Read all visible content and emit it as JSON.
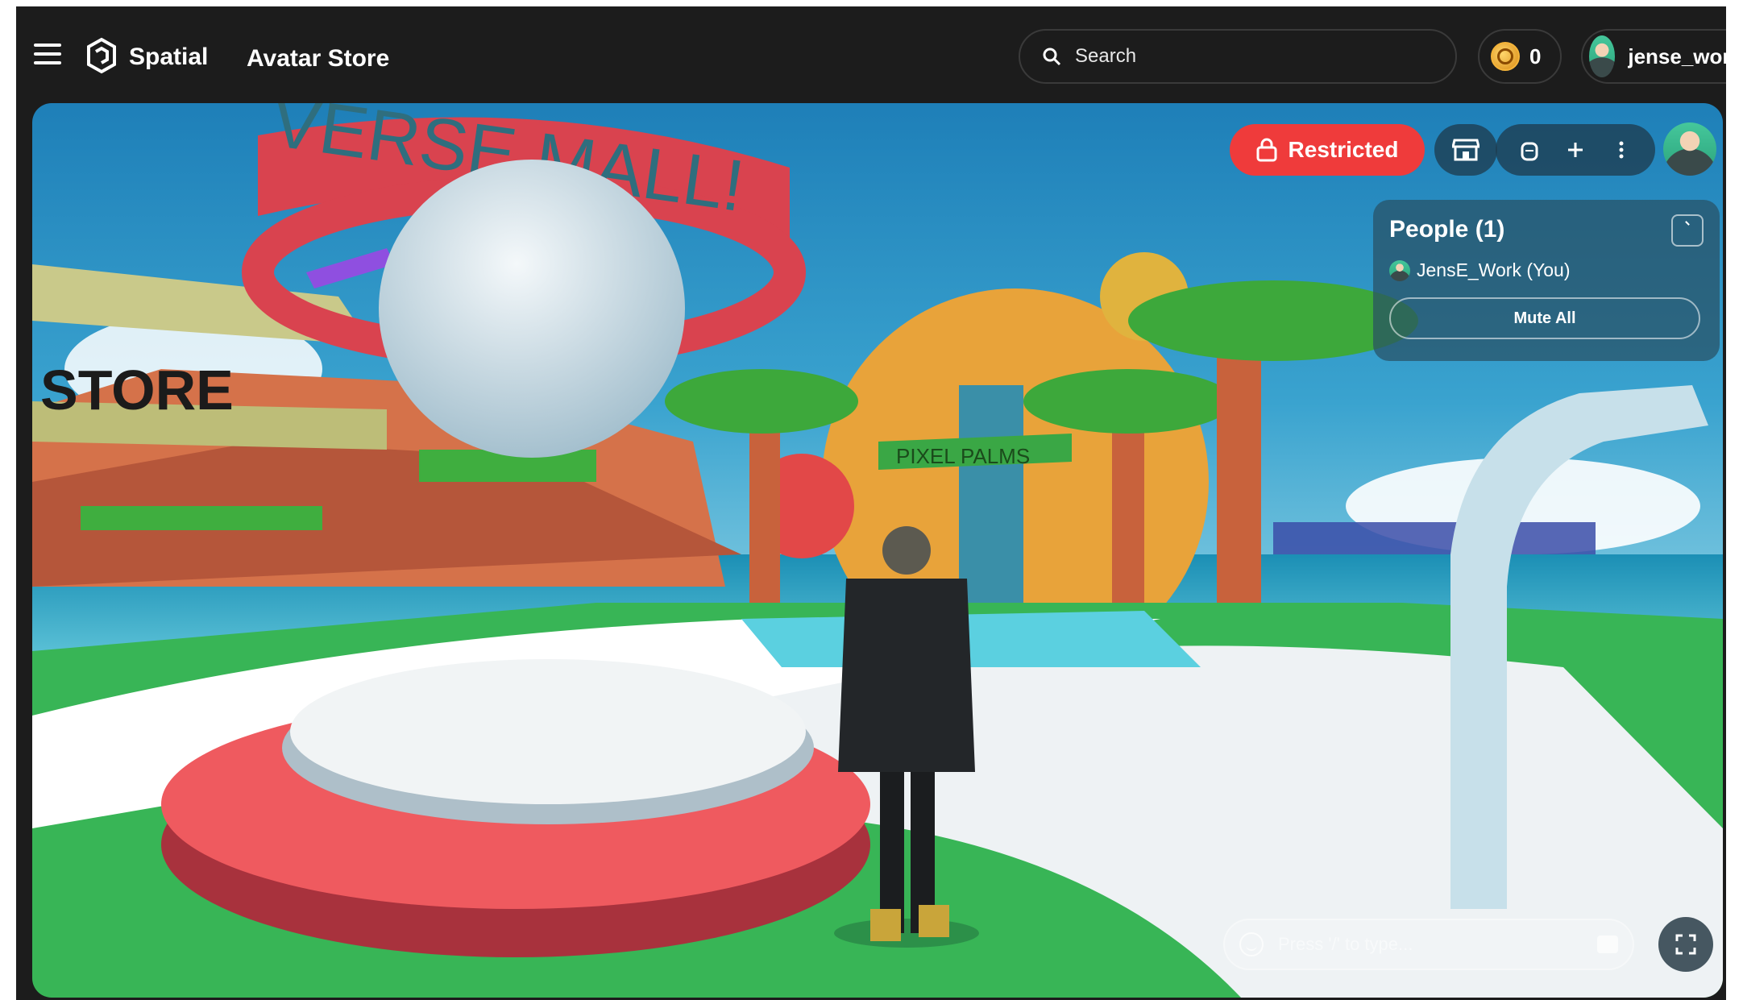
{
  "header": {
    "brand": "Spatial",
    "title": "Avatar Store",
    "search_label": "Search",
    "coin_balance": "0",
    "username": "jense_work"
  },
  "overlay": {
    "restricted_label": "Restricted",
    "people": {
      "title": "People (1)",
      "members": [
        {
          "name": "JensE_Work (You)"
        }
      ],
      "mute_all_label": "Mute All"
    },
    "chat_placeholder": "Press '/' to type..."
  },
  "scene": {
    "sign_mall": "VERSE MALL!",
    "sign_palms": "PIXEL PALMS",
    "sign_store": "STORE"
  },
  "colors": {
    "restricted": "#ef3b3b",
    "topbar": "#1c1c1c"
  }
}
